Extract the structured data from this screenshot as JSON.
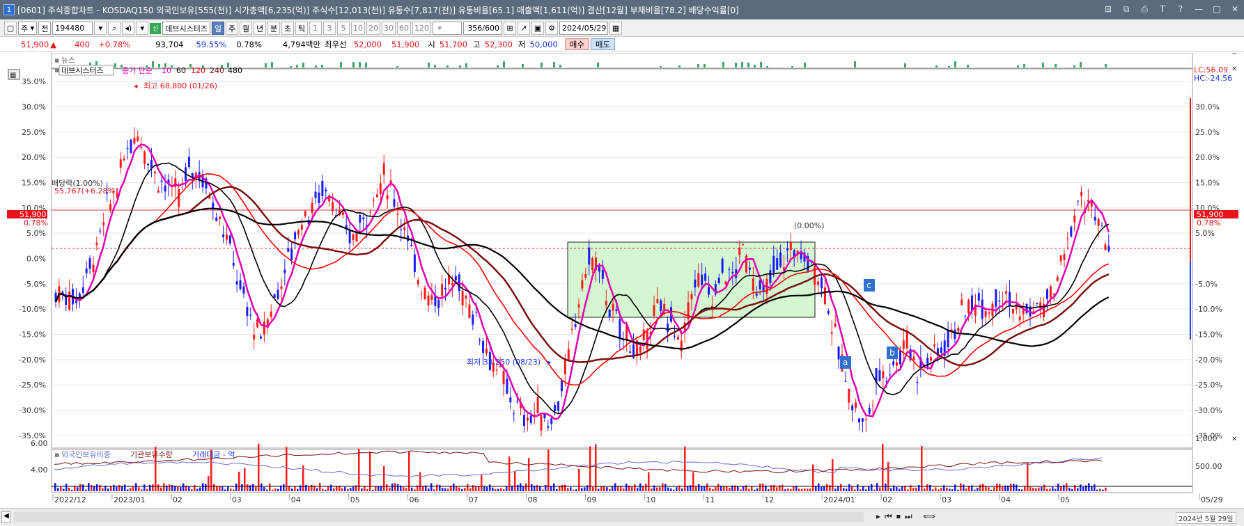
{
  "window": {
    "number": "1",
    "title": "[0601] 주식종합차트 - KOSDAQ150 외국인보유[555(천)] 시가총액[6,235(억)] 주식수[12,013(천)] 유통수[7,817(천)] 유통비율[65.1] 매출액[1,611(억)] 결산[12월] 부채비율[78.2] 배당수익률[0]"
  },
  "toolbar": {
    "type_select": "주",
    "market_select": "전",
    "code": "194480",
    "company_badge": "신",
    "company": "데브시스터즈",
    "periods": [
      "일",
      "주",
      "월",
      "년",
      "분",
      "초",
      "틱"
    ],
    "selected_period": "일",
    "intervals": [
      "1",
      "3",
      "5",
      "10",
      "20",
      "30",
      "60",
      "120"
    ],
    "range": "356/600",
    "date": "2024/05/29"
  },
  "pricebar": {
    "price": "51,900",
    "change": "400",
    "change_pct": "+0.78%",
    "volume": "93,704",
    "ratio1": "59.55%",
    "ratio2": "0.78%",
    "amount": "4,794백만",
    "best_label": "최우선",
    "best_ask": "52,000",
    "best_bid": "51,900",
    "open_label": "시",
    "open": "51,700",
    "high_label": "고",
    "high": "52,300",
    "low_label": "저",
    "low": "50,000",
    "buy_label": "매수",
    "sell_label": "매도"
  },
  "news_label": "뉴스",
  "legend": {
    "name": "데브시스터즈",
    "ma_label": "종가 단순",
    "ma_periods": [
      "10",
      "60",
      "120",
      "240",
      "480"
    ],
    "ma_colors": [
      "#e400b0",
      "#000000",
      "#ff0000",
      "#7a1010",
      "#000000"
    ]
  },
  "annotations": {
    "max_label": "최고 68,800 (01/26)",
    "min_label": "최저 33,250 (08/23)",
    "dividend_label": "배당락(1.00%)",
    "dividend_price": "55,767(+6.28%)",
    "box_label": "(0.00%)",
    "lc": "LC:56.09",
    "hc": "HC:-24.56",
    "price_tag": "51,900",
    "price_pct": "0.78%",
    "wave_a": "a",
    "wave_b": "b",
    "wave_c": "c"
  },
  "lower_legend": {
    "foreign": "외국인보유비중",
    "inst": "기관보유수량",
    "amount": "거래대금 - 억"
  },
  "chart_data": {
    "type": "line",
    "y_ticks_pct": [
      "35.0%",
      "30.0%",
      "25.0%",
      "20.0%",
      "15.0%",
      "10.0%",
      "5.0%",
      "0.0%",
      "-5.0%",
      "-10.0%",
      "-15.0%",
      "-20.0%",
      "-25.0%",
      "-30.0%",
      "-35.0%"
    ],
    "y_ticks_pct_right": [
      "30.0%",
      "25.0%",
      "20.0%",
      "15.0%",
      "10.0%",
      "5.0%",
      "-5.0%",
      "-10.0%",
      "-15.0%",
      "-20.0%",
      "-25.0%",
      "-30.0%",
      "-35.0%"
    ],
    "ylim_pct": [
      -37.5,
      37.5
    ],
    "lower_y_ticks_left": [
      "6.00",
      "4.00"
    ],
    "lower_y_ticks_right": [
      "1,000",
      "500.00"
    ],
    "x_labels": [
      "2022/12",
      "2023/01",
      "02",
      "03",
      "04",
      "05",
      "06",
      "07",
      "08",
      "09",
      "10",
      "11",
      "12",
      "2024/01",
      "02",
      "03",
      "04",
      "05",
      "05/29"
    ],
    "close_pct_series": [
      -7,
      -8,
      -3,
      2,
      10,
      14,
      22,
      25,
      20,
      16,
      14,
      12,
      18,
      17,
      13,
      8,
      2,
      -6,
      -12,
      -16,
      -10,
      -4,
      2,
      8,
      10,
      14,
      12,
      6,
      4,
      8,
      12,
      16,
      12,
      6,
      -2,
      -6,
      -8,
      -6,
      -4,
      -8,
      -12,
      -18,
      -22,
      -26,
      -30,
      -32,
      -30,
      -33,
      -28,
      -20,
      -8,
      0,
      -2,
      -10,
      -14,
      -16,
      -20,
      -12,
      -10,
      -12,
      -18,
      -6,
      -4,
      -8,
      -2,
      -4,
      2,
      -4,
      -8,
      -2,
      0,
      2,
      0,
      -2,
      -6,
      -16,
      -24,
      -30,
      -33,
      -24,
      -22,
      -20,
      -16,
      -22,
      -20,
      -18,
      -16,
      -12,
      -10,
      -8,
      -10,
      -6,
      -8,
      -12,
      -10,
      -10,
      -8,
      -2,
      6,
      12,
      10,
      4,
      2
    ]
  },
  "statusbar": {
    "datetime": "2024년 5월 29일"
  }
}
